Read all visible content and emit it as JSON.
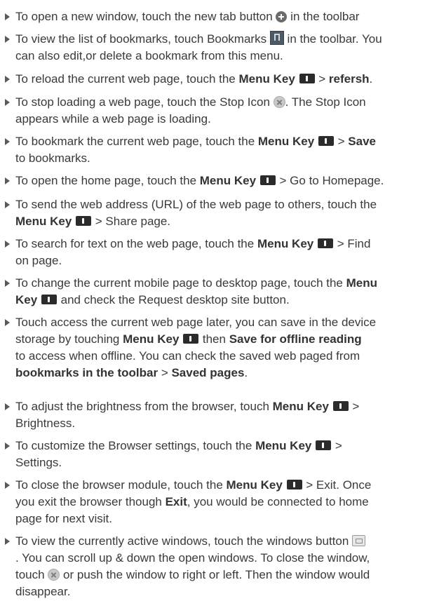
{
  "items": [
    {
      "lines": [
        [
          {
            "t": "To open a new window, touch the new tab button "
          },
          {
            "icon": "plus-circle-icon"
          },
          {
            "t": " in the toolbar"
          }
        ]
      ]
    },
    {
      "lines": [
        [
          {
            "t": "To view the list of bookmarks, touch Bookmarks "
          },
          {
            "icon": "bookmark-icon"
          },
          {
            "t": " in the toolbar. You"
          }
        ],
        [
          {
            "t": "can also edit,or delete a bookmark from this menu."
          }
        ]
      ]
    },
    {
      "lines": [
        [
          {
            "t": "To reload the current web page, touch the "
          },
          {
            "t": "Menu Key",
            "b": true
          },
          {
            "t": " "
          },
          {
            "icon": "menu-key-icon"
          },
          {
            "t": " > "
          },
          {
            "t": "refersh",
            "b": true
          },
          {
            "t": "."
          }
        ]
      ]
    },
    {
      "lines": [
        [
          {
            "t": "To stop loading a web page, touch the Stop Icon "
          },
          {
            "icon": "stop-icon"
          },
          {
            "t": ". The Stop Icon"
          }
        ],
        [
          {
            "t": "appears while a web page is loading."
          }
        ]
      ]
    },
    {
      "lines": [
        [
          {
            "t": "To bookmark the current web page, touch the "
          },
          {
            "t": "Menu Key",
            "b": true
          },
          {
            "t": " "
          },
          {
            "icon": "menu-key-icon"
          },
          {
            "t": " > "
          },
          {
            "t": "Save",
            "b": true
          }
        ],
        [
          {
            "t": "to bookmarks."
          }
        ]
      ]
    },
    {
      "lines": [
        [
          {
            "t": "To open the home page, touch the "
          },
          {
            "t": "Menu Key",
            "b": true
          },
          {
            "t": " "
          },
          {
            "icon": "menu-key-icon"
          },
          {
            "t": " > Go to Homepage."
          }
        ]
      ]
    },
    {
      "lines": [
        [
          {
            "t": "To send the web address (URL) of the web page to others, touch the"
          }
        ],
        [
          {
            "t": "Menu Key",
            "b": true
          },
          {
            "t": " "
          },
          {
            "icon": "menu-key-icon"
          },
          {
            "t": " > Share page."
          }
        ]
      ]
    },
    {
      "lines": [
        [
          {
            "t": "To search for text on the web page, touch the "
          },
          {
            "t": "Menu Key",
            "b": true
          },
          {
            "t": " "
          },
          {
            "icon": "menu-key-icon"
          },
          {
            "t": " > Find"
          }
        ],
        [
          {
            "t": "on page."
          }
        ]
      ]
    },
    {
      "lines": [
        [
          {
            "t": "To change the current mobile page to desktop page, touch the "
          },
          {
            "t": "Menu",
            "b": true
          }
        ],
        [
          {
            "t": "Key",
            "b": true
          },
          {
            "t": " "
          },
          {
            "icon": "menu-key-icon"
          },
          {
            "t": " and check the Request desktop site button."
          }
        ]
      ]
    },
    {
      "lines": [
        [
          {
            "t": "Touch access the current web page later, you can save in the device"
          }
        ],
        [
          {
            "t": "storage by touching "
          },
          {
            "t": "Menu Key",
            "b": true
          },
          {
            "t": " "
          },
          {
            "icon": "menu-key-icon"
          },
          {
            "t": " then "
          },
          {
            "t": "Save for offline reading",
            "b": true
          }
        ],
        [
          {
            "t": "to access when offline. You can check the saved web paged  from"
          }
        ],
        [
          {
            "t": "bookmarks in the toolbar",
            "b": true
          },
          {
            "t": " > "
          },
          {
            "t": "Saved pages",
            "b": true
          },
          {
            "t": "."
          }
        ]
      ]
    },
    {
      "lines": [
        [
          {
            "t": "To adjust the brightness from the browser, touch "
          },
          {
            "t": "Menu Key",
            "b": true
          },
          {
            "t": " "
          },
          {
            "icon": "menu-key-icon"
          },
          {
            "t": " >"
          }
        ],
        [
          {
            "t": "Brightness."
          }
        ]
      ]
    },
    {
      "lines": [
        [
          {
            "t": "To customize the Browser settings, touch the "
          },
          {
            "t": "Menu Key",
            "b": true
          },
          {
            "t": " "
          },
          {
            "icon": "menu-key-icon"
          },
          {
            "t": " >"
          }
        ],
        [
          {
            "t": "Settings."
          }
        ]
      ]
    },
    {
      "lines": [
        [
          {
            "t": "To close the browser module, touch the "
          },
          {
            "t": "Menu Key",
            "b": true
          },
          {
            "t": " "
          },
          {
            "icon": "menu-key-icon"
          },
          {
            "t": " > Exit. Once"
          }
        ],
        [
          {
            "t": "you exit the browser though "
          },
          {
            "t": "Exit",
            "b": true
          },
          {
            "t": ", you would be connected to home"
          }
        ],
        [
          {
            "t": "page for next visit."
          }
        ]
      ]
    },
    {
      "lines": [
        [
          {
            "t": "To view the currently active windows, touch the windows button "
          },
          {
            "icon": "windows-icon"
          }
        ],
        [
          {
            "t": ". You can scroll up & down the open windows. To close the window,"
          }
        ],
        [
          {
            "t": "touch "
          },
          {
            "icon": "stop-icon"
          },
          {
            "t": " or push the window to right or left. Then the window would"
          }
        ],
        [
          {
            "t": "disappear."
          }
        ]
      ]
    }
  ]
}
